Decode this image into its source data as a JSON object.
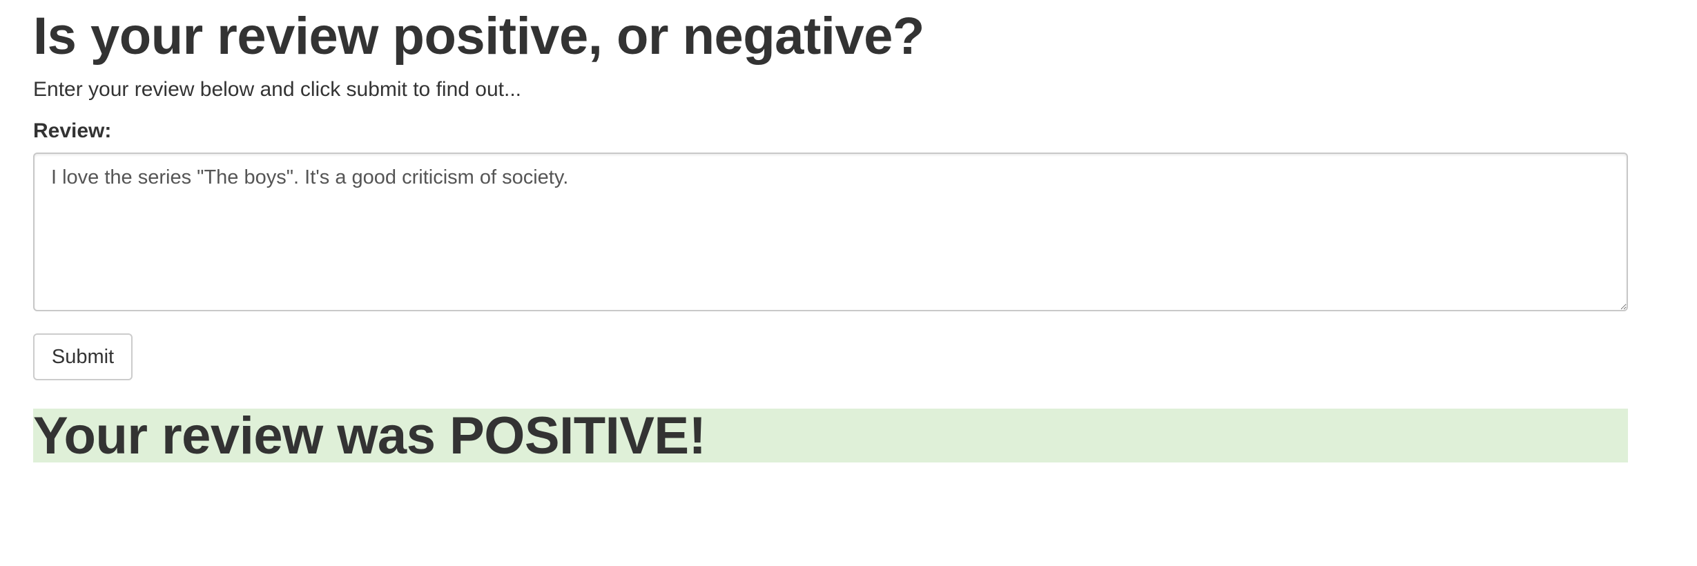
{
  "page": {
    "title": "Is your review positive, or negative?",
    "subtitle": "Enter your review below and click submit to find out..."
  },
  "form": {
    "review_label": "Review:",
    "review_value": "I love the series \"The boys\". It's a good criticism of society.",
    "submit_label": "Submit"
  },
  "result": {
    "text": "Your review was POSITIVE!",
    "background_color": "#dff0d8"
  }
}
